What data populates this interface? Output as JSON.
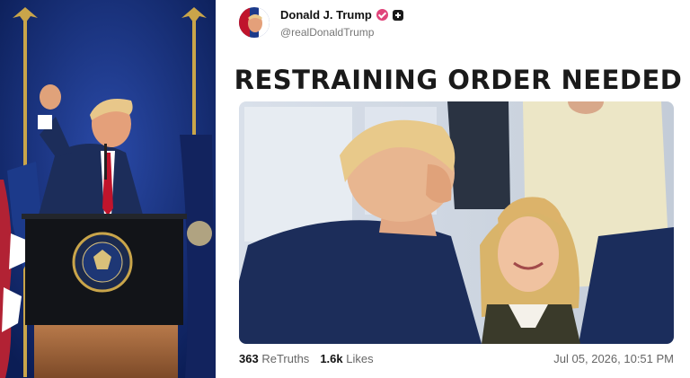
{
  "post": {
    "display_name": "Donald J. Trump",
    "handle": "@realDonaldTrump",
    "headline": "RESTRAINING ORDER NEEDED",
    "retruths_count": "363",
    "retruths_label": "ReTruths",
    "likes_count": "1.6k",
    "likes_label": "Likes",
    "timestamp": "Jul 05, 2026, 10:51 PM"
  },
  "icons": {
    "verified": "verified-icon",
    "badge": "plus-badge-icon"
  },
  "colors": {
    "verified_pink": "#e0447a",
    "stage_blue": "#0f2a6b",
    "suit_navy": "#1c2d5a"
  }
}
